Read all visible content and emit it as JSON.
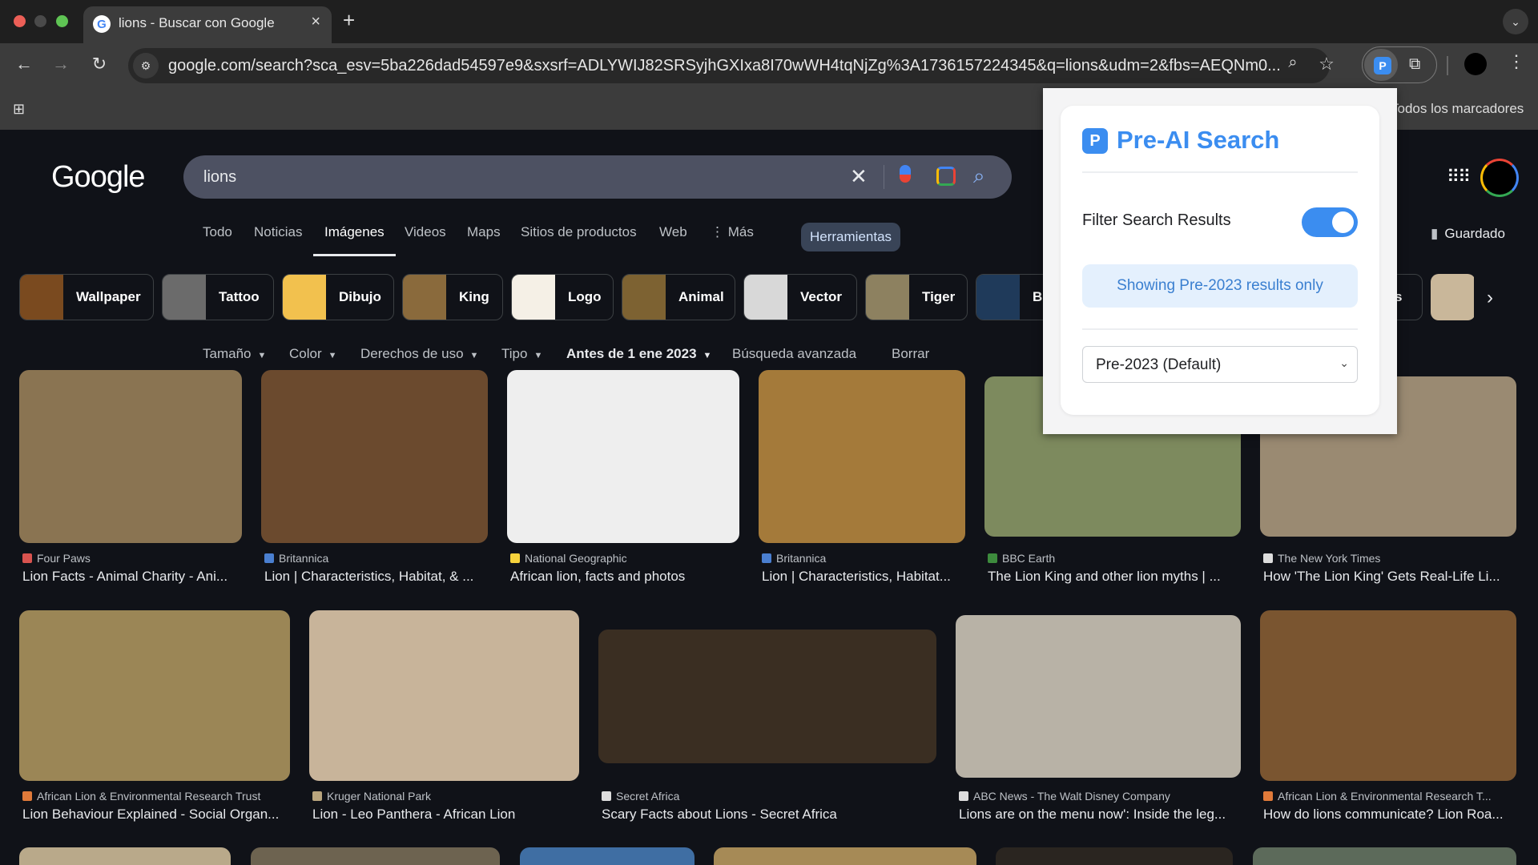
{
  "browser": {
    "tab_title": "lions - Buscar con Google",
    "tab_close": "×",
    "new_tab": "+",
    "url": "google.com/search?sca_esv=5ba226dad54597e9&sxsrf=ADLYWIJ82SRSyjhGXIxa8I70wWH4tqNjZg%3A1736157224345&q=lions&udm=2&fbs=AEQNm0...",
    "bookmarks_all": "Todos los marcadores",
    "extension_letter": "P"
  },
  "google": {
    "logo": "Google",
    "query": "lions",
    "nav_tabs": [
      {
        "label": "Todo",
        "active": false
      },
      {
        "label": "Noticias",
        "active": false
      },
      {
        "label": "Imágenes",
        "active": true
      },
      {
        "label": "Videos",
        "active": false
      },
      {
        "label": "Maps",
        "active": false
      },
      {
        "label": "Sitios de productos",
        "active": false
      },
      {
        "label": "Web",
        "active": false
      },
      {
        "label": "⋮ Más",
        "active": false
      }
    ],
    "tools_label": "Herramientas",
    "saved_label": "Guardado",
    "chips": [
      {
        "label": "Wallpaper",
        "color": "#7a4a1f"
      },
      {
        "label": "Tattoo",
        "color": "#6b6b6b"
      },
      {
        "label": "Dibujo",
        "color": "#f2c14e"
      },
      {
        "label": "King",
        "color": "#8a6a3c"
      },
      {
        "label": "Logo",
        "color": "#f5f0e6"
      },
      {
        "label": "Animal",
        "color": "#7d6232"
      },
      {
        "label": "Vector",
        "color": "#d8d8d8"
      },
      {
        "label": "Tiger",
        "color": "#8d8160"
      },
      {
        "label": "B",
        "color": "#1f3a5a"
      },
      {
        "label": "s",
        "color": "#333333"
      },
      {
        "label": "",
        "color": "#c9b79a"
      }
    ],
    "filters": [
      {
        "label": "Tamaño",
        "caret": true,
        "bold": false
      },
      {
        "label": "Color",
        "caret": true,
        "bold": false
      },
      {
        "label": "Derechos de uso",
        "caret": true,
        "bold": false
      },
      {
        "label": "Tipo",
        "caret": true,
        "bold": false
      },
      {
        "label": "Antes de 1 ene 2023",
        "caret": true,
        "bold": true
      },
      {
        "label": "Búsqueda avanzada",
        "caret": false,
        "bold": false
      },
      {
        "label": "Borrar",
        "caret": false,
        "bold": false
      }
    ],
    "results": [
      {
        "source": "Four Paws",
        "title": "Lion Facts - Animal Charity - Ani...",
        "color": "#8a7452",
        "icon": "#d9534f"
      },
      {
        "source": "Britannica",
        "title": "Lion | Characteristics, Habitat, & ...",
        "color": "#6b4a2e",
        "icon": "#4a7fd0"
      },
      {
        "source": "National Geographic",
        "title": "African lion, facts and photos",
        "color": "#eeeeee",
        "icon": "#f6d23c"
      },
      {
        "source": "Britannica",
        "title": "Lion | Characteristics, Habitat...",
        "color": "#a47a3a",
        "icon": "#4a7fd0"
      },
      {
        "source": "BBC Earth",
        "title": "The Lion King and other lion myths | ...",
        "color": "#7d8a5e",
        "icon": "#3d8b3d"
      },
      {
        "source": "The New York Times",
        "title": "How 'The Lion King' Gets Real-Life Li...",
        "color": "#9a8a72",
        "icon": "#dddddd"
      },
      {
        "source": "African Lion & Environmental Research Trust",
        "title": "Lion Behaviour Explained - Social Organ...",
        "color": "#9b8656",
        "icon": "#e07a3a"
      },
      {
        "source": "Kruger National Park",
        "title": "Lion - Leo Panthera - African Lion",
        "color": "#c8b49a",
        "icon": "#b9a57e"
      },
      {
        "source": "Secret Africa",
        "title": "Scary Facts about Lions - Secret Africa",
        "color": "#3a2e22",
        "icon": "#dddddd"
      },
      {
        "source": "ABC News - The Walt Disney Company",
        "title": "Lions are on the menu now': Inside the leg...",
        "color": "#b8b2a6",
        "icon": "#dddddd"
      },
      {
        "source": "African Lion & Environmental Research T...",
        "title": "How do lions communicate? Lion Roa...",
        "color": "#7a5530",
        "icon": "#e07a3a"
      }
    ]
  },
  "extension_popup": {
    "logo_letter": "P",
    "title": "Pre-AI Search",
    "filter_label": "Filter Search Results",
    "filter_enabled": true,
    "status_banner": "Showing Pre-2023 results only",
    "cutoff_select_value": "Pre-2023 (Default)",
    "accent_color": "#3b8df0"
  }
}
